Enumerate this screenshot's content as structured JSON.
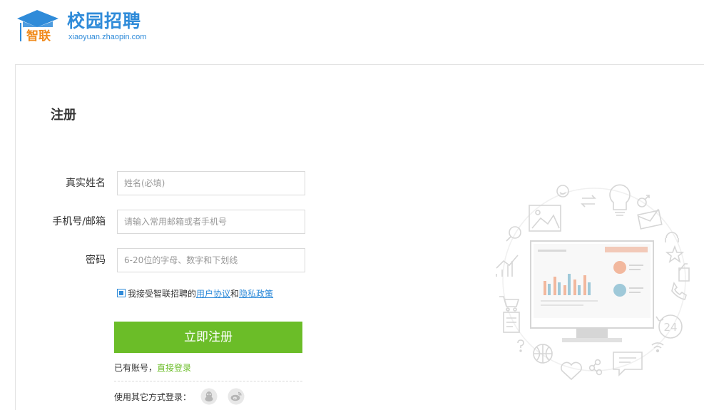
{
  "brand": {
    "logo_text": "智联",
    "title": "校园招聘",
    "url": "xiaoyuan.zhaopin.com"
  },
  "page_title": "注册",
  "form": {
    "name": {
      "label": "真实姓名",
      "placeholder": "姓名(必填)"
    },
    "account": {
      "label": "手机号/邮箱",
      "placeholder": "请输入常用邮箱或者手机号"
    },
    "password": {
      "label": "密码",
      "placeholder": "6-20位的字母、数字和下划线"
    },
    "agreement": {
      "checked": true,
      "prefix": "我接受智联招聘的",
      "user_agreement": "用户协议",
      "and": "和",
      "privacy_policy": "隐私政策"
    },
    "submit_label": "立即注册"
  },
  "login": {
    "prefix": "已有账号，",
    "link": "直接登录"
  },
  "other_login": {
    "label": "使用其它方式登录：",
    "providers": [
      "qq-icon",
      "weibo-icon"
    ]
  },
  "illustration": {
    "badge_text": "24"
  },
  "colors": {
    "brand_blue": "#2f8bd9",
    "button_green": "#6bbd28",
    "logo_orange": "#f08a1c"
  }
}
